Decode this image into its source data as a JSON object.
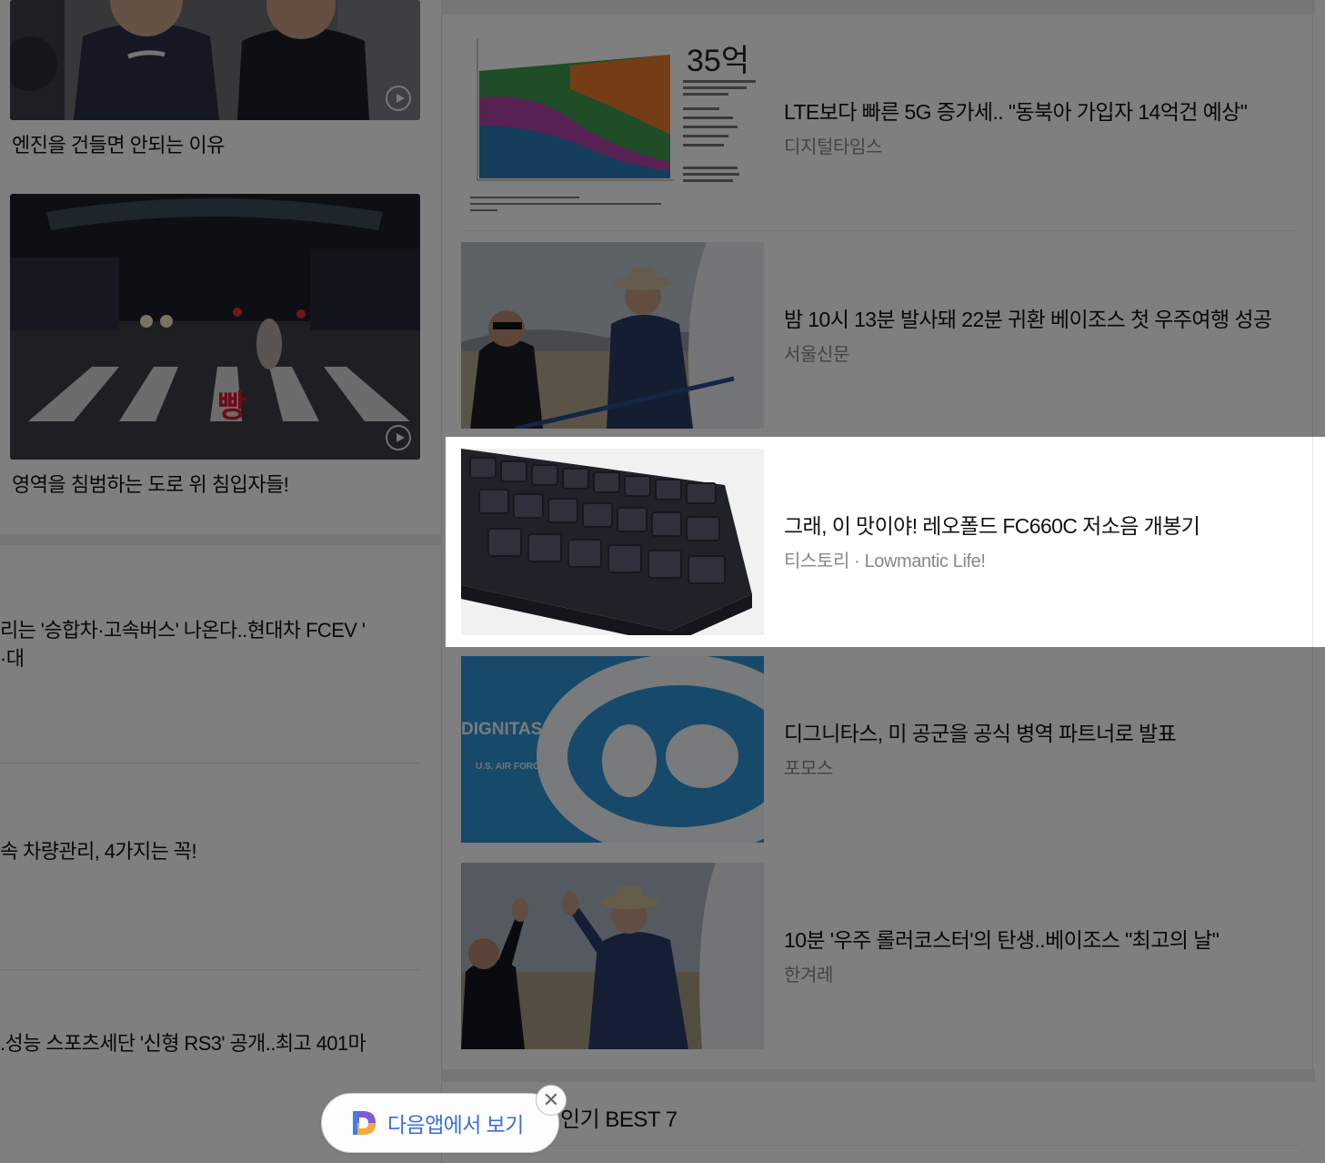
{
  "left": {
    "videos": [
      {
        "caption": "엔진을 건들면 안되는 이유"
      },
      {
        "caption": "영역을 침범하는 도로 위 침입자들!",
        "overlay_text": "빵"
      }
    ],
    "news": [
      {
        "line1": "리는 '승합차·고속버스' 나온다..현대차 FCEV '",
        "line2": "·대"
      },
      {
        "line1": " 속 차량관리, 4가지는 꼭!"
      },
      {
        "line1": ".성능 스포츠세단 '신형 RS3' 공개..최고 401마"
      }
    ]
  },
  "right": {
    "news": [
      {
        "title": "LTE보다 빠른 5G 증가세.. \"동북아 가입자 14억건 예상\"",
        "source": "디지털타임스",
        "thumb_big_text": "35억"
      },
      {
        "title": "밤 10시 13분 발사돼 22분 귀환 베이조스 첫 우주여행 성공",
        "source": "서울신문"
      },
      {
        "title": "그래, 이 맛이야! 레오폴드 FC660C 저소음 개봉기",
        "source": "티스토리 · Lowmantic Life!"
      },
      {
        "title": "디그니타스, 미 공군을 공식 병역 파트너로 발표",
        "source": "포모스",
        "thumb_text_1": "DIGNITAS",
        "thumb_text_2": "U.S. AIR FORCE"
      },
      {
        "title": "10분 '우주 롤러코스터'의 탄생..베이조스 \"최고의 날\"",
        "source": "한겨레"
      }
    ],
    "section_heading": "인기 BEST 7"
  },
  "app_banner": {
    "label": "다음앱에서 보기",
    "close_symbol": "✕"
  },
  "colors": {
    "app_banner_text": "#3b6fd9",
    "dim_overlay": "rgba(0,0,0,0.5)"
  }
}
